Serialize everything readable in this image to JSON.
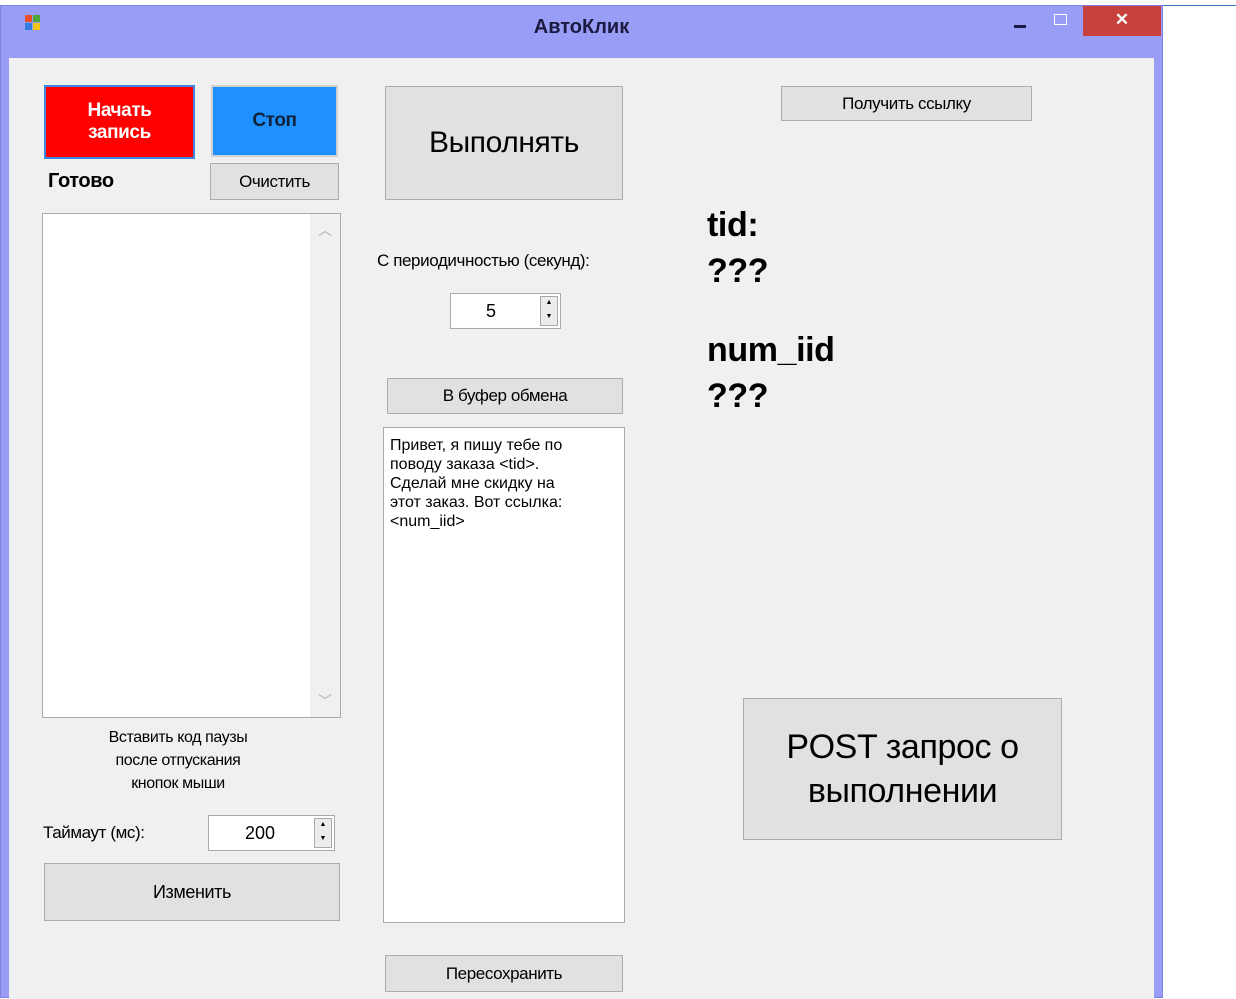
{
  "window": {
    "title": "АвтоКлик",
    "close_glyph": "✕"
  },
  "left": {
    "start_record_label": "Начать\nзапись",
    "stop_label": "Стоп",
    "status_text": "Готово",
    "clear_label": "Очистить",
    "scroll_up_glyph": "︿",
    "scroll_down_glyph": "﹀",
    "pause_code_label": "Вставить код паузы\nпосле отпускания\nкнопок мыши",
    "timeout_label": "Таймаут (мс):",
    "timeout_value": "200",
    "change_label": "Изменить"
  },
  "middle": {
    "execute_label": "Выполнять",
    "period_label": "С периодичностью (секунд):",
    "period_value": "5",
    "clipboard_label": "В буфер обмена",
    "message_text": "Привет, я пишу тебе по\nповоду заказа <tid>.\nСделай мне скидку на\nэтот заказ. Вот ссылка:\n<num_iid>",
    "resave_label": "Пересохранить"
  },
  "right": {
    "get_link_label": "Получить ссылку",
    "tid_label": "tid:",
    "tid_value": "???",
    "num_iid_label": "num_iid",
    "num_iid_value": "???",
    "post_request_label": "POST запрос о\nвыполнении"
  },
  "colors": {
    "start_button": "#fe0000",
    "stop_button": "#1e90ff",
    "titlebar": "#9a9df6",
    "close_button": "#c7423c"
  },
  "icons": {
    "app": "app-icon",
    "spin_up": "▲",
    "spin_down": "▼"
  }
}
